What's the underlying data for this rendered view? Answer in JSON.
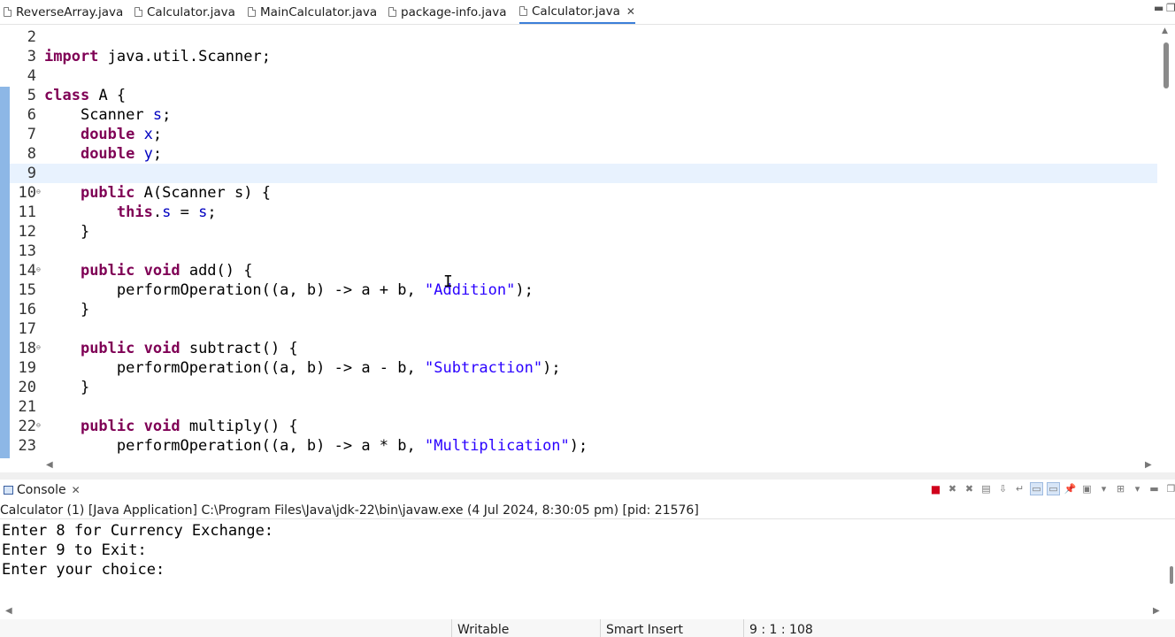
{
  "editor_tabs": [
    {
      "label": "ReverseArray.java",
      "active": false
    },
    {
      "label": "Calculator.java",
      "active": false
    },
    {
      "label": "MainCalculator.java",
      "active": false
    },
    {
      "label": "package-info.java",
      "active": false
    },
    {
      "label": "Calculator.java",
      "active": true
    }
  ],
  "editor": {
    "current_line": 9,
    "lines": [
      {
        "num": "2",
        "text": ""
      },
      {
        "num": "3",
        "text": "import java.util.Scanner;"
      },
      {
        "num": "4",
        "text": ""
      },
      {
        "num": "5",
        "text": "class A {"
      },
      {
        "num": "6",
        "text": "    Scanner s;"
      },
      {
        "num": "7",
        "text": "    double x;"
      },
      {
        "num": "8",
        "text": "    double y;"
      },
      {
        "num": "9",
        "text": ""
      },
      {
        "num": "10",
        "text": "    public A(Scanner s) {",
        "fold": true
      },
      {
        "num": "11",
        "text": "        this.s = s;"
      },
      {
        "num": "12",
        "text": "    }"
      },
      {
        "num": "13",
        "text": ""
      },
      {
        "num": "14",
        "text": "    public void add() {",
        "fold": true
      },
      {
        "num": "15",
        "text": "        performOperation((a, b) -> a + b, \"Addition\");"
      },
      {
        "num": "16",
        "text": "    }"
      },
      {
        "num": "17",
        "text": ""
      },
      {
        "num": "18",
        "text": "    public void subtract() {",
        "fold": true
      },
      {
        "num": "19",
        "text": "        performOperation((a, b) -> a - b, \"Subtraction\");"
      },
      {
        "num": "20",
        "text": "    }"
      },
      {
        "num": "21",
        "text": ""
      },
      {
        "num": "22",
        "text": "    public void multiply() {",
        "fold": true
      },
      {
        "num": "23",
        "text": "        performOperation((a, b) -> a * b, \"Multiplication\");"
      }
    ]
  },
  "console": {
    "tab_label": "Console",
    "description": "Calculator (1) [Java Application] C:\\Program Files\\Java\\jdk-22\\bin\\javaw.exe  (4 Jul 2024, 8:30:05 pm) [pid: 21576]",
    "output": [
      "Enter 8 for Currency Exchange:",
      "Enter 9 to Exit:",
      "Enter your choice:"
    ]
  },
  "status": {
    "writable": "Writable",
    "insert_mode": "Smart Insert",
    "position": "9 : 1 : 108"
  },
  "colors": {
    "keyword": "#7f0055",
    "field": "#0000c0",
    "string": "#2a00ff",
    "current_line": "#e8f2fe",
    "active_tab_underline": "#3c7fd8",
    "terminate": "#d0001c"
  }
}
